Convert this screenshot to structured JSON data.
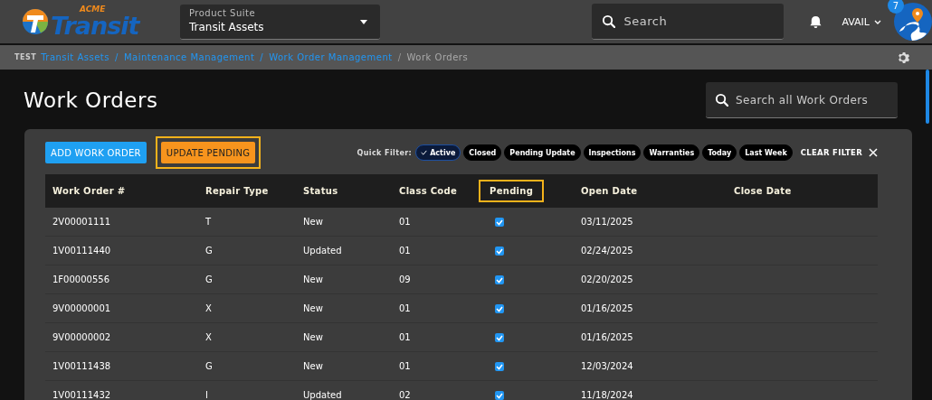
{
  "header": {
    "logo": {
      "small": "ACME",
      "large": "Transit"
    },
    "product_suite": {
      "label": "Product Suite",
      "value": "Transit Assets"
    },
    "search": {
      "placeholder": "Search"
    },
    "user": "AVAIL",
    "notification_count": "7"
  },
  "breadcrumb": {
    "env": "TEST",
    "separator": "/",
    "links": [
      "Transit Assets",
      "Maintenance Management",
      "Work Order Management"
    ],
    "current": "Work Orders"
  },
  "page": {
    "title": "Work Orders",
    "search": {
      "placeholder": "Search all Work Orders"
    }
  },
  "actions": [
    {
      "label": "ADD WORK ORDER",
      "kind": "primary",
      "highlighted": false
    },
    {
      "label": "UPDATE PENDING",
      "kind": "warning",
      "highlighted": true
    }
  ],
  "quick_filter": {
    "label": "Quick Filter:",
    "chips": [
      {
        "label": "Active",
        "selected": true
      },
      {
        "label": "Closed",
        "selected": false
      },
      {
        "label": "Pending Update",
        "selected": false
      },
      {
        "label": "Inspections",
        "selected": false
      },
      {
        "label": "Warranties",
        "selected": false
      },
      {
        "label": "Today",
        "selected": false
      },
      {
        "label": "Last Week",
        "selected": false
      }
    ],
    "clear": "CLEAR FILTER"
  },
  "table": {
    "columns": [
      {
        "label": "Work Order #",
        "highlighted": false
      },
      {
        "label": "Repair Type",
        "highlighted": false
      },
      {
        "label": "Status",
        "highlighted": false
      },
      {
        "label": "Class Code",
        "highlighted": false
      },
      {
        "label": "Pending",
        "highlighted": true
      },
      {
        "label": "Open Date",
        "highlighted": false
      },
      {
        "label": "Close Date",
        "highlighted": false
      }
    ],
    "rows": [
      {
        "work_order": "2V00001111",
        "repair_type": "T",
        "status": "New",
        "class_code": "01",
        "pending": true,
        "open_date": "03/11/2025"
      },
      {
        "work_order": "1V00111440",
        "repair_type": "G",
        "status": "Updated",
        "class_code": "01",
        "pending": true,
        "open_date": "02/24/2025"
      },
      {
        "work_order": "1F00000556",
        "repair_type": "G",
        "status": "New",
        "class_code": "09",
        "pending": true,
        "open_date": "02/20/2025"
      },
      {
        "work_order": "9V00000001",
        "repair_type": "X",
        "status": "New",
        "class_code": "01",
        "pending": true,
        "open_date": "01/16/2025"
      },
      {
        "work_order": "9V00000002",
        "repair_type": "X",
        "status": "New",
        "class_code": "01",
        "pending": true,
        "open_date": "01/16/2025"
      },
      {
        "work_order": "1V00111438",
        "repair_type": "G",
        "status": "New",
        "class_code": "01",
        "pending": true,
        "open_date": "12/03/2024"
      },
      {
        "work_order": "1V00111432",
        "repair_type": "I",
        "status": "Updated",
        "class_code": "02",
        "pending": true,
        "open_date": "11/18/2024"
      }
    ]
  }
}
